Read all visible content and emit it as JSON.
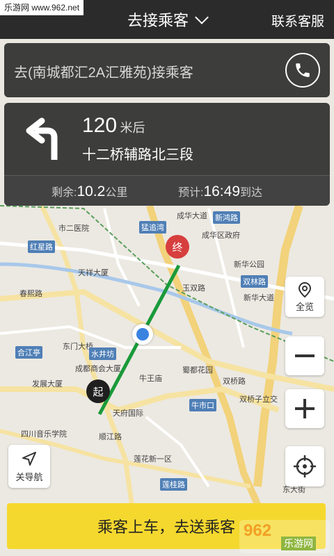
{
  "watermark": "乐游网 www.962.net",
  "header": {
    "title": "去接乘客",
    "service": "联系客服"
  },
  "destination": {
    "text": "去(南城都汇2A汇雅苑)接乘客"
  },
  "navigation": {
    "distance": "120",
    "distance_unit": "米后",
    "road": "十二桥辅路北三段",
    "remaining_label": "剩余:",
    "remaining_value": "10.2",
    "remaining_unit": "公里",
    "eta_label": "预计:",
    "eta_value": "16:49",
    "eta_unit": "到达"
  },
  "map": {
    "labels": [
      "市二医院",
      "红星路",
      "春熙路",
      "天祥大厦",
      "东门大桥",
      "成都商会大厦",
      "发展大厦",
      "天府国际",
      "四川音乐学院",
      "合江亭",
      "成华大道",
      "成华区政府",
      "新华公园",
      "新华大道",
      "双林路",
      "蜀都花园",
      "牛王庙",
      "双桥子立交",
      "牛市口",
      "莲花新一区",
      "莲桂路",
      "玉双路",
      "猛追湾",
      "新鸿路",
      "顺江路",
      "水井坊",
      "双桥路",
      "东大街"
    ],
    "end_marker": "终",
    "start_marker": "起"
  },
  "controls": {
    "overview": "全览",
    "close_nav": "关导航"
  },
  "bottom_button": {
    "label": "乘客上车，去送乘客"
  },
  "brand": {
    "top": "962",
    "bottom": "乐游网"
  },
  "colors": {
    "route": "#1a9a3a",
    "bottom_button": "#f5d82e",
    "panel": "#2e2e2e",
    "end_marker": "#d73e3e",
    "location": "#3a82e0"
  }
}
